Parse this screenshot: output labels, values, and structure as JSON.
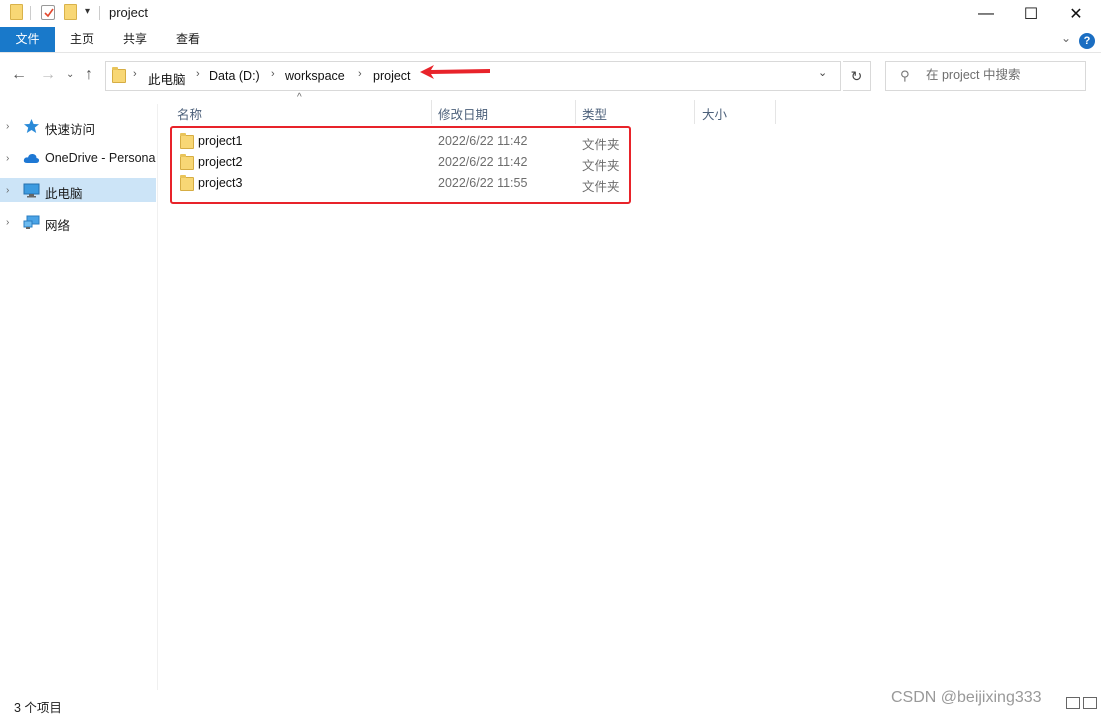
{
  "window": {
    "title": "project",
    "controls": {
      "minimize": "—",
      "maximize": "☐",
      "close": "✕"
    }
  },
  "ribbon": {
    "tabs": [
      "文件",
      "主页",
      "共享",
      "查看"
    ],
    "help": "?"
  },
  "address": {
    "crumbs": [
      "此电脑",
      "Data (D:)",
      "workspace",
      "project"
    ],
    "search_placeholder": "在 project 中搜索"
  },
  "sidebar": {
    "items": [
      {
        "label": "快速访问",
        "icon": "star-icon"
      },
      {
        "label": "OneDrive - Personal",
        "icon": "cloud-icon"
      },
      {
        "label": "此电脑",
        "icon": "computer-icon",
        "selected": true
      },
      {
        "label": "网络",
        "icon": "network-icon"
      }
    ]
  },
  "columns": {
    "name": "名称",
    "date": "修改日期",
    "type": "类型",
    "size": "大小"
  },
  "files": [
    {
      "name": "project1",
      "date": "2022/6/22 11:42",
      "type": "文件夹"
    },
    {
      "name": "project2",
      "date": "2022/6/22 11:42",
      "type": "文件夹"
    },
    {
      "name": "project3",
      "date": "2022/6/22 11:55",
      "type": "文件夹"
    }
  ],
  "status": {
    "count": "3 个项目"
  },
  "watermark": "CSDN @beijixing333",
  "colors": {
    "accent": "#1979ca",
    "annotation": "#e8232a",
    "folder": "#f8d775",
    "selected": "#cce4f7"
  }
}
